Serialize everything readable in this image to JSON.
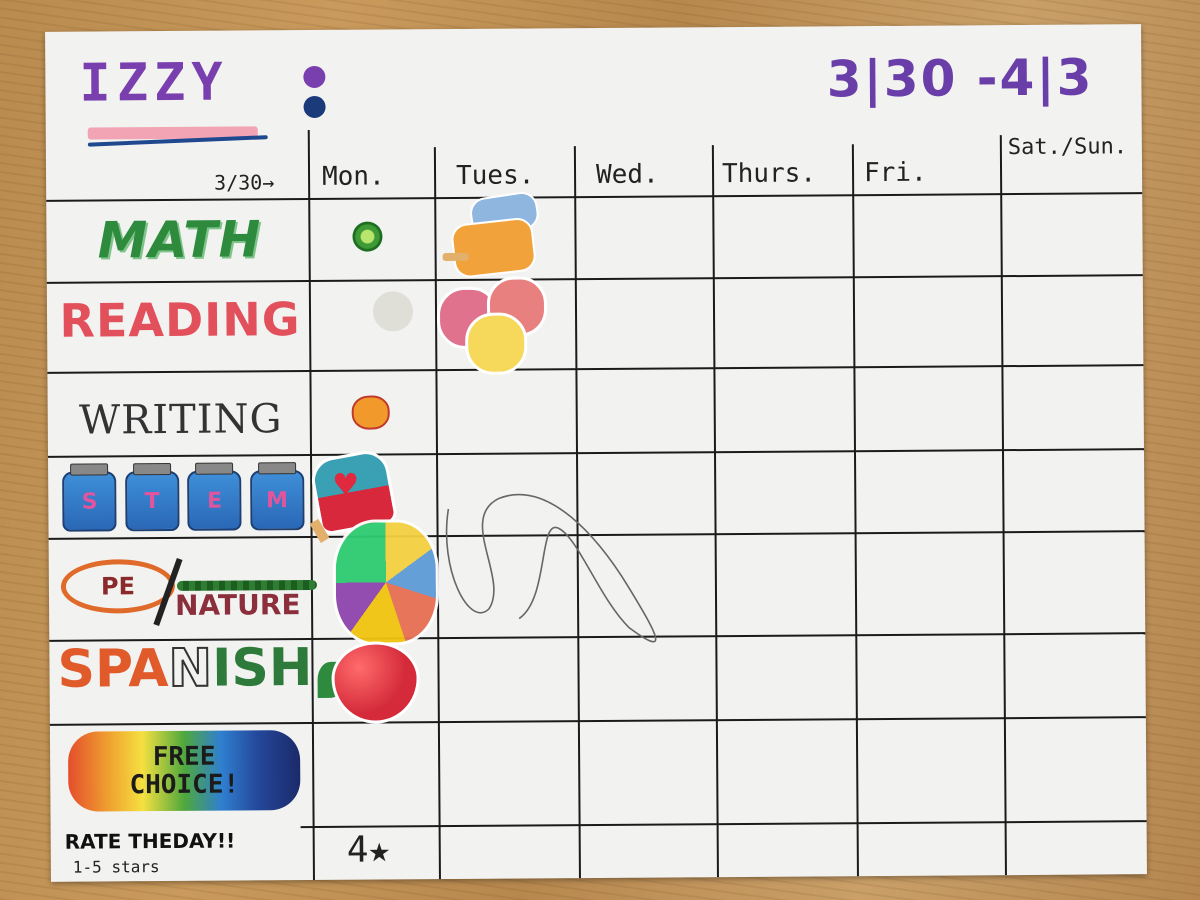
{
  "chart": {
    "name": "IZZY",
    "colon_colors": [
      "#7a3fae",
      "#1a3a7a"
    ],
    "dates": "3|30 -4|3",
    "week_of": "3/30→",
    "days": [
      "Mon.",
      "Tues.",
      "Wed.",
      "Thurs.",
      "Fri.",
      "Sat./Sun."
    ],
    "subjects": {
      "math": "MATH",
      "reading": "READING",
      "writing": "WRITING",
      "stem_letters": [
        "S",
        "T",
        "E",
        "M"
      ],
      "pe": "PE",
      "nature": "NATURE",
      "spanish_part1": "SPA",
      "spanish_part2": "N",
      "spanish_part3": "ISH",
      "free_line1": "FREE",
      "free_line2": "CHOICE!"
    },
    "rate_label": "RATE THEDAY!!",
    "rate_sub": "1-5 stars",
    "monday_rating": "4★",
    "colors": {
      "math": "#2e8b3e",
      "reading": "#e2505b",
      "name": "#7a3fae",
      "dates": "#6a3ea8"
    }
  }
}
